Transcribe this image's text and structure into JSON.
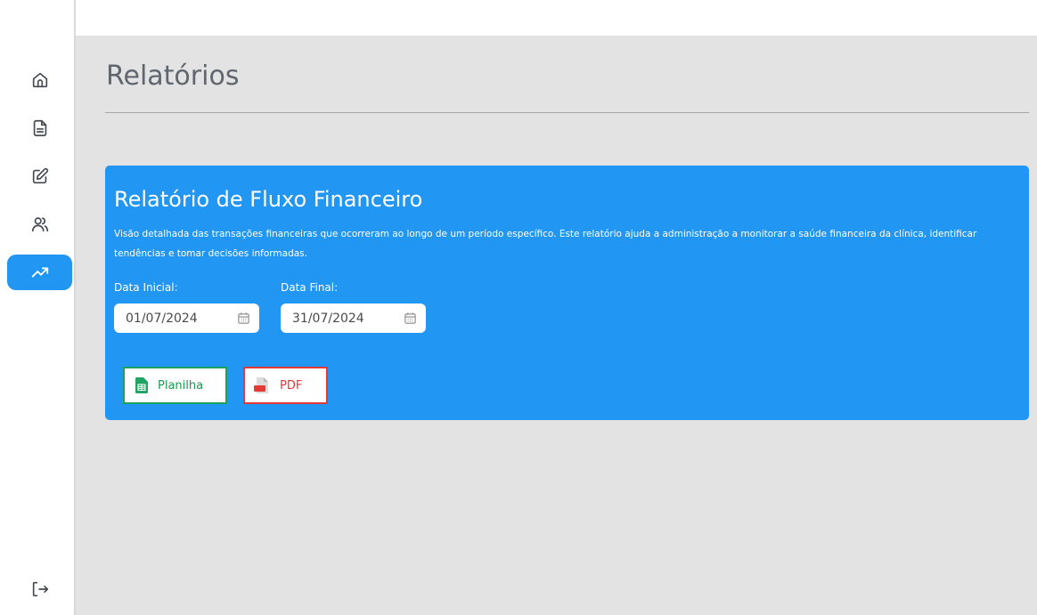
{
  "sidebar": {
    "items": [
      {
        "name": "home",
        "icon": "home-icon",
        "active": false
      },
      {
        "name": "documents",
        "icon": "document-icon",
        "active": false
      },
      {
        "name": "edit",
        "icon": "edit-icon",
        "active": false
      },
      {
        "name": "users",
        "icon": "users-icon",
        "active": false
      },
      {
        "name": "reports",
        "icon": "trending-up-icon",
        "active": true
      }
    ],
    "logout_icon": "logout-icon"
  },
  "page": {
    "title": "Relatórios"
  },
  "report": {
    "title": "Relatório de Fluxo Financeiro",
    "description": "Visão detalhada das transações financeiras que ocorreram ao longo de um período específico. Este relatório ajuda a administração a monitorar a saúde financeira da clínica, identificar tendências e tomar decisões informadas.",
    "start_label": "Data Inicial:",
    "start_value": "01/07/2024",
    "end_label": "Data Final:",
    "end_value": "31/07/2024",
    "spreadsheet_label": "Planilha",
    "pdf_label": "PDF"
  },
  "colors": {
    "accent": "#2196f3",
    "background": "#e3e3e3",
    "spreadsheet": "#1aa260",
    "pdf": "#e53935"
  }
}
